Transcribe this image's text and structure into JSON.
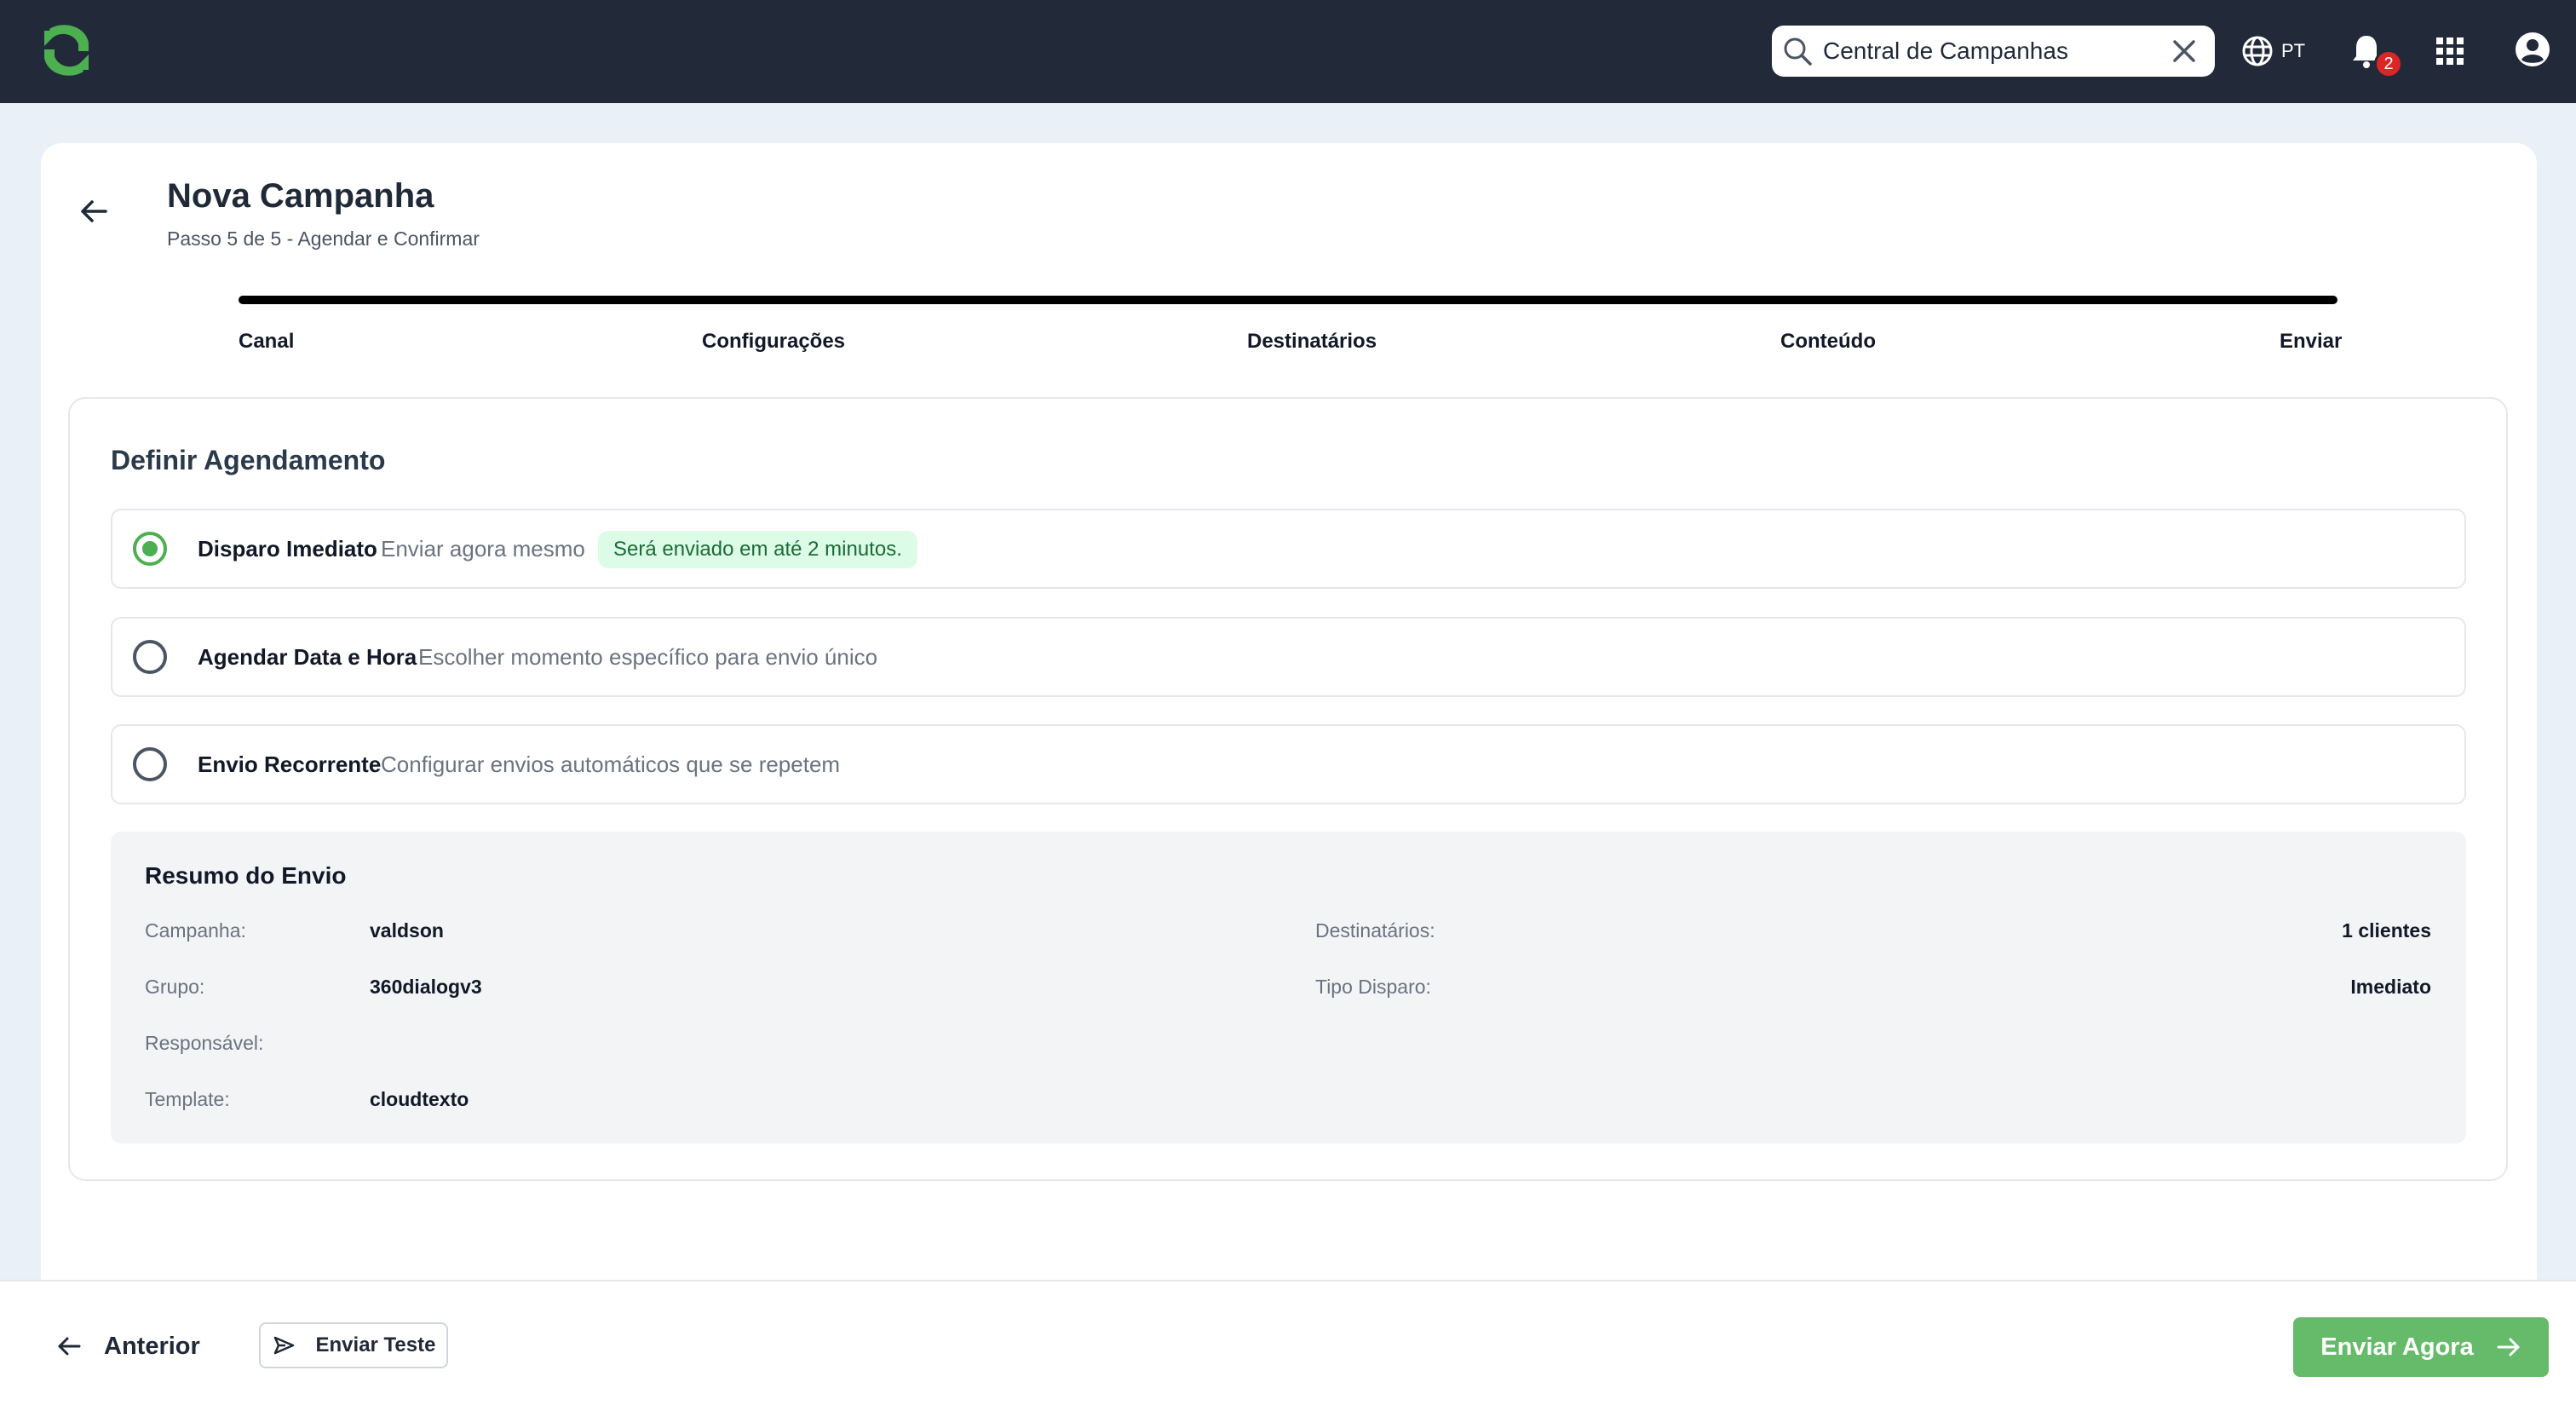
{
  "header": {
    "logo_icon": "refresh-logo-icon",
    "search": {
      "value": "Central de Campanhas",
      "icon": "search-icon"
    },
    "language": "PT",
    "notifications_count": "2",
    "colors": {
      "topbar": "#222a3a",
      "logo": "#4caf50"
    }
  },
  "page": {
    "title": "Nova Campanha",
    "subtitle": "Passo 5 de 5 - Agendar e Confirmar",
    "progress_percent": 100
  },
  "steps": [
    "Canal",
    "Configurações",
    "Destinatários",
    "Conteúdo",
    "Enviar"
  ],
  "schedule": {
    "title": "Definir Agendamento",
    "options": [
      {
        "title": "Disparo Imediato",
        "description": "Enviar agora mesmo",
        "note": "Será enviado em até 2 minutos.",
        "selected": true
      },
      {
        "title": "Agendar Data e Hora",
        "description": "Escolher momento específico para envio único",
        "selected": false
      },
      {
        "title": "Envio Recorrente",
        "description": "Configurar envios automáticos que se repetem",
        "selected": false
      }
    ]
  },
  "summary": {
    "title": "Resumo do Envio",
    "left": [
      {
        "label": "Campanha:",
        "value": "valdson"
      },
      {
        "label": "Grupo:",
        "value": "360dialogv3"
      },
      {
        "label": "Responsável:",
        "value": ""
      },
      {
        "label": "Template:",
        "value": "cloudtexto"
      }
    ],
    "right": [
      {
        "label": "Destinatários:",
        "value": "1 clientes"
      },
      {
        "label": "Tipo Disparo:",
        "value": "Imediato"
      }
    ]
  },
  "footer": {
    "previous_label": "Anterior",
    "test_label": "Enviar Teste",
    "send_label": "Enviar Agora",
    "accent_color": "#66bb6a"
  }
}
